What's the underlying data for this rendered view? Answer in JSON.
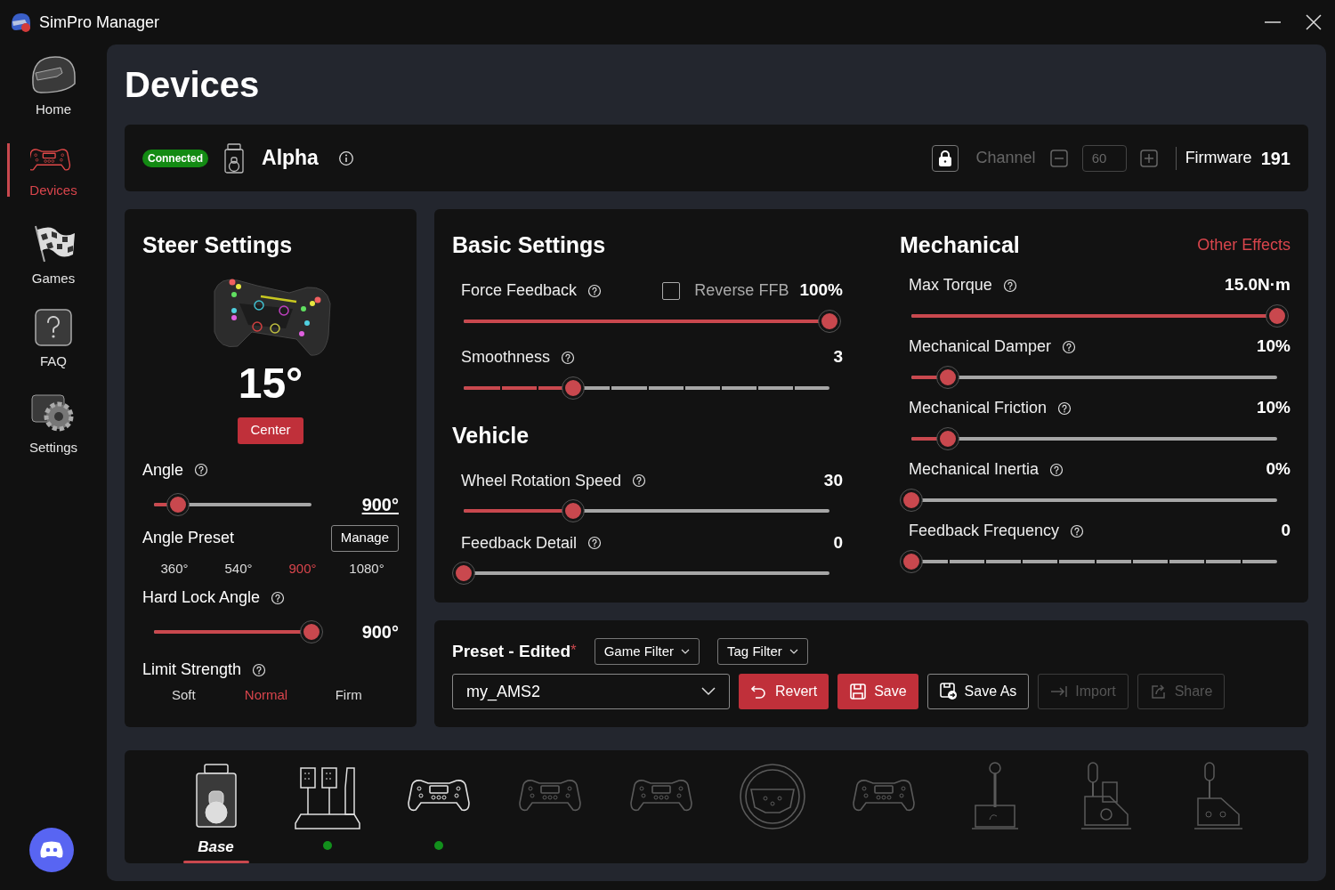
{
  "window": {
    "title": "SimPro Manager"
  },
  "nav": [
    {
      "label": "Home",
      "selected": false
    },
    {
      "label": "Devices",
      "selected": true
    },
    {
      "label": "Games",
      "selected": false
    },
    {
      "label": "FAQ",
      "selected": false
    },
    {
      "label": "Settings",
      "selected": false
    }
  ],
  "page_title": "Devices",
  "device_bar": {
    "status": "Connected",
    "name": "Alpha",
    "channel_label": "Channel",
    "channel": "60",
    "channel_disabled": true,
    "firmware_label": "Firmware",
    "firmware": "191"
  },
  "steer": {
    "title": "Steer Settings",
    "current_angle": "15°",
    "center_button": "Center",
    "angle": {
      "label": "Angle",
      "value": "900°",
      "level": 0.15,
      "kind": "continuous",
      "editable": true
    },
    "angle_preset": {
      "label": "Angle Preset",
      "manage_button": "Manage",
      "options": [
        {
          "label": "360°",
          "selected": false
        },
        {
          "label": "540°",
          "selected": false
        },
        {
          "label": "900°",
          "selected": true
        },
        {
          "label": "1080°",
          "selected": false
        }
      ]
    },
    "hard_lock": {
      "label": "Hard Lock Angle",
      "value": "900°",
      "level": 1,
      "kind": "continuous",
      "editable": false
    },
    "limit_strength": {
      "label": "Limit Strength",
      "options": [
        {
          "label": "Soft",
          "selected": false
        },
        {
          "label": "Normal",
          "selected": true
        },
        {
          "label": "Firm",
          "selected": false
        }
      ]
    }
  },
  "basic": {
    "title": "Basic Settings",
    "items": [
      {
        "label": "Force Feedback",
        "value": "100%",
        "level": 1,
        "kind": "continuous",
        "reverse": {
          "label": "Reverse FFB",
          "checked": false
        }
      },
      {
        "label": "Smoothness",
        "value": "3",
        "level": 0.3,
        "kind": "stepped"
      }
    ]
  },
  "vehicle": {
    "title": "Vehicle",
    "items": [
      {
        "label": "Wheel Rotation Speed",
        "value": "30",
        "level": 0.3,
        "kind": "continuous"
      },
      {
        "label": "Feedback Detail",
        "value": "0",
        "level": 0,
        "kind": "continuous"
      }
    ]
  },
  "mechanical": {
    "title": "Mechanical",
    "link": "Other Effects",
    "items": [
      {
        "label": "Max Torque",
        "value": "15.0N·m",
        "level": 1,
        "kind": "continuous"
      },
      {
        "label": "Mechanical Damper",
        "value": "10%",
        "level": 0.1,
        "kind": "continuous"
      },
      {
        "label": "Mechanical Friction",
        "value": "10%",
        "level": 0.1,
        "kind": "continuous"
      },
      {
        "label": "Mechanical Inertia",
        "value": "0%",
        "level": 0,
        "kind": "continuous"
      },
      {
        "label": "Feedback Frequency",
        "value": "0",
        "level": 0,
        "kind": "stepped"
      }
    ]
  },
  "preset": {
    "title": "Preset - Edited",
    "edited_mark": "*",
    "filters": [
      "Game Filter",
      "Tag Filter"
    ],
    "selected": "my_AMS2",
    "buttons": [
      {
        "label": "Revert",
        "kind": "primary",
        "disabled": false
      },
      {
        "label": "Save",
        "kind": "primary",
        "disabled": false
      },
      {
        "label": "Save As",
        "kind": "outline",
        "disabled": false
      },
      {
        "label": "Import",
        "kind": "outline",
        "disabled": true
      },
      {
        "label": "Share",
        "kind": "outline",
        "disabled": true
      }
    ]
  },
  "devices": [
    {
      "label": "Base",
      "kind": "base",
      "selected": true,
      "available": true,
      "connected": false
    },
    {
      "kind": "pedals",
      "selected": false,
      "available": true,
      "connected": true
    },
    {
      "kind": "wheel",
      "selected": false,
      "available": true,
      "connected": true
    },
    {
      "kind": "wheel",
      "selected": false,
      "available": false,
      "connected": false
    },
    {
      "kind": "wheel",
      "selected": false,
      "available": false,
      "connected": false
    },
    {
      "kind": "round",
      "selected": false,
      "available": false,
      "connected": false
    },
    {
      "kind": "wheel",
      "selected": false,
      "available": false,
      "connected": false
    },
    {
      "kind": "handbrake",
      "selected": false,
      "available": false,
      "connected": false
    },
    {
      "kind": "sequential",
      "selected": false,
      "available": false,
      "connected": false
    },
    {
      "kind": "shifter",
      "selected": false,
      "available": false,
      "connected": false
    }
  ]
}
